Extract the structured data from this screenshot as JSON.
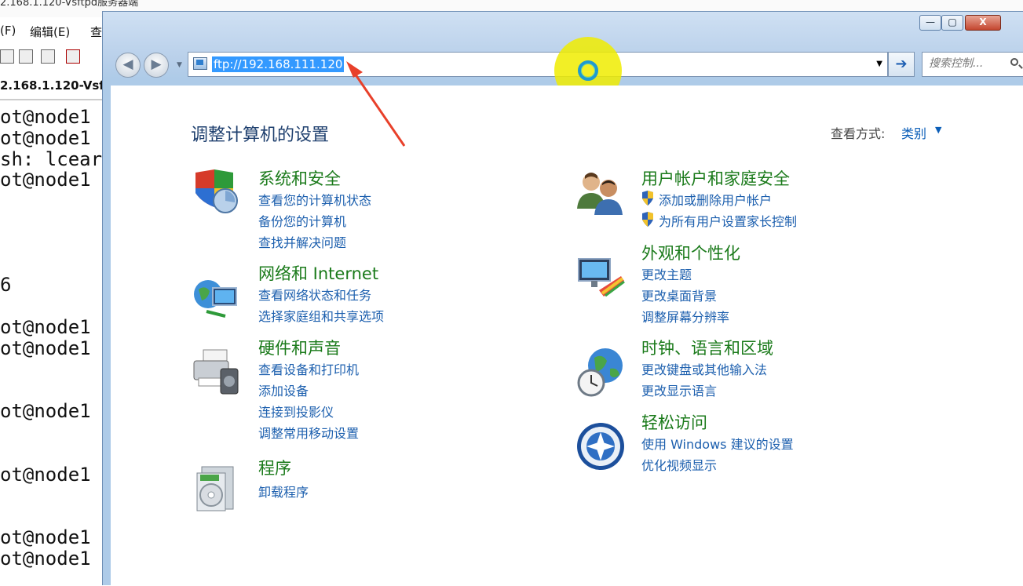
{
  "background": {
    "window_title": "2.168.1.120-Vsftpd服务器端",
    "menu": [
      "(F)",
      "编辑(E)",
      "查"
    ],
    "tab_label": "2.168.1.120-Vsft",
    "terminal_lines": [
      {
        "text": "ot@node1",
        "row": 1
      },
      {
        "text": "ot@node1",
        "row": 2
      },
      {
        "text": "sh: lcear",
        "row": 3
      },
      {
        "text": "ot@node1",
        "row": 4
      },
      {
        "text": "6",
        "row": 9
      },
      {
        "text": "ot@node1",
        "row": 11
      },
      {
        "text": "ot@node1",
        "row": 12
      },
      {
        "text": "ot@node1",
        "row": 15
      },
      {
        "text": "ot@node1",
        "row": 18
      },
      {
        "text": "ot@node1",
        "row": 21
      },
      {
        "text": "ot@node1",
        "row": 22
      }
    ]
  },
  "explorer": {
    "address": "ftp://192.168.111.120",
    "search_placeholder": "搜索控制...",
    "window_buttons": {
      "minimize": "—",
      "maximize": "▢",
      "close": "X"
    }
  },
  "control_panel": {
    "title": "调整计算机的设置",
    "view_by_label": "查看方式:",
    "view_by_value": "类别",
    "left_categories": [
      {
        "title": "系统和安全",
        "icon": "shield-icon",
        "links": [
          "查看您的计算机状态",
          "备份您的计算机",
          "查找并解决问题"
        ]
      },
      {
        "title": "网络和 Internet",
        "icon": "network-icon",
        "links": [
          "查看网络状态和任务",
          "选择家庭组和共享选项"
        ]
      },
      {
        "title": "硬件和声音",
        "icon": "printer-icon",
        "links": [
          "查看设备和打印机",
          "添加设备",
          "连接到投影仪",
          "调整常用移动设置"
        ]
      },
      {
        "title": "程序",
        "icon": "programs-icon",
        "links": [
          "卸载程序"
        ]
      }
    ],
    "right_categories": [
      {
        "title": "用户帐户和家庭安全",
        "icon": "users-icon",
        "links": [
          "添加或删除用户帐户",
          "为所有用户设置家长控制"
        ]
      },
      {
        "title": "外观和个性化",
        "icon": "monitor-icon",
        "links": [
          "更改主题",
          "更改桌面背景",
          "调整屏幕分辨率"
        ]
      },
      {
        "title": "时钟、语言和区域",
        "icon": "globe-clock-icon",
        "links": [
          "更改键盘或其他输入法",
          "更改显示语言"
        ]
      },
      {
        "title": "轻松访问",
        "icon": "ease-of-access-icon",
        "links": [
          "使用 Windows 建议的设置",
          "优化视频显示"
        ]
      }
    ]
  },
  "colors": {
    "category_title": "#1a7a1a",
    "link": "#1c5fae",
    "annotation_arrow": "#e8402a",
    "cursor_highlight": "#f0ec00"
  }
}
